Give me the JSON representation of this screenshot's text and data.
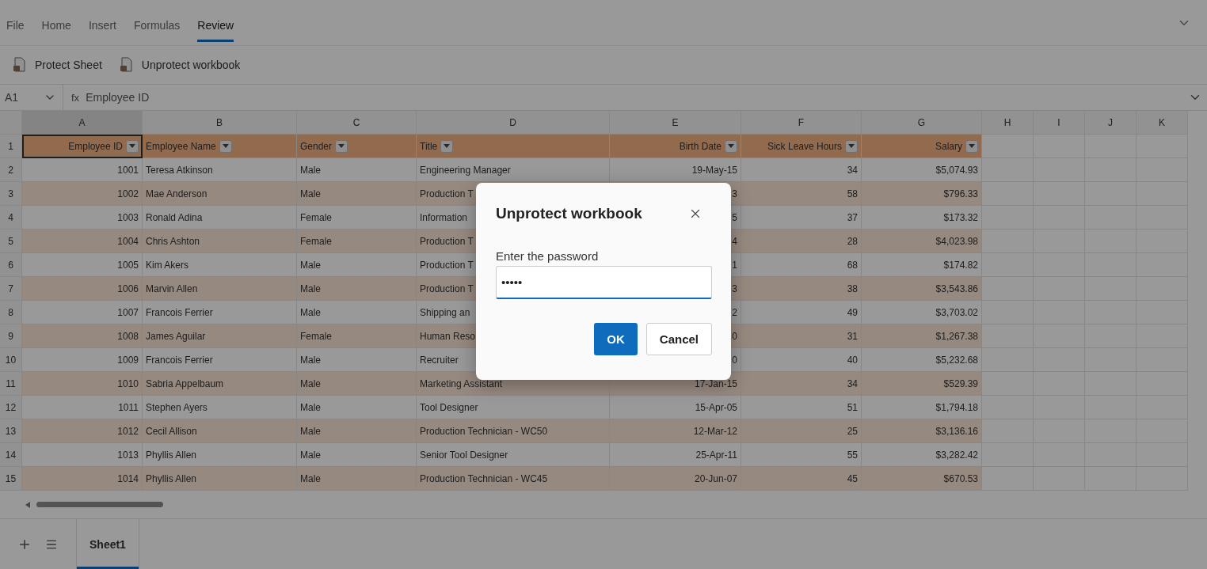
{
  "menu_tabs": [
    {
      "label": "File",
      "selected": false
    },
    {
      "label": "Home",
      "selected": false
    },
    {
      "label": "Insert",
      "selected": false
    },
    {
      "label": "Formulas",
      "selected": false
    },
    {
      "label": "Review",
      "selected": true
    }
  ],
  "toolbar": [
    {
      "label": "Protect Sheet"
    },
    {
      "label": "Unprotect workbook"
    }
  ],
  "formula_bar": {
    "name_box": "A1",
    "fx": "fx",
    "formula": "Employee ID"
  },
  "column_headers": [
    {
      "label": "A",
      "selected": true
    },
    {
      "label": "B",
      "selected": false
    },
    {
      "label": "C",
      "selected": false
    },
    {
      "label": "D",
      "selected": false
    },
    {
      "label": "E",
      "selected": false
    },
    {
      "label": "F",
      "selected": false
    },
    {
      "label": "G",
      "selected": false
    },
    {
      "label": "H",
      "selected": false
    },
    {
      "label": "I",
      "selected": false
    },
    {
      "label": "J",
      "selected": false
    },
    {
      "label": "K",
      "selected": false
    }
  ],
  "header_row": {
    "number": "1",
    "cells": [
      "Employee ID",
      "Employee Name",
      "Gender",
      "Title",
      "Birth Date",
      "Sick Leave Hours",
      "Salary"
    ]
  },
  "rows": [
    {
      "number": "2",
      "cells": [
        "1001",
        "Teresa Atkinson",
        "Male",
        "Engineering Manager",
        "19-May-15",
        "34",
        "$5,074.93"
      ]
    },
    {
      "number": "3",
      "cells": [
        "1002",
        "Mae Anderson",
        "Male",
        "Production T",
        "3",
        "58",
        "$796.33"
      ]
    },
    {
      "number": "4",
      "cells": [
        "1003",
        "Ronald Adina",
        "Female",
        "Information",
        "5",
        "37",
        "$173.32"
      ]
    },
    {
      "number": "5",
      "cells": [
        "1004",
        "Chris Ashton",
        "Female",
        "Production T",
        "4",
        "28",
        "$4,023.98"
      ]
    },
    {
      "number": "6",
      "cells": [
        "1005",
        "Kim Akers",
        "Male",
        "Production T",
        "1",
        "68",
        "$174.82"
      ]
    },
    {
      "number": "7",
      "cells": [
        "1006",
        "Marvin Allen",
        "Male",
        "Production T",
        "3",
        "38",
        "$3,543.86"
      ]
    },
    {
      "number": "8",
      "cells": [
        "1007",
        "Francois Ferrier",
        "Male",
        "Shipping an",
        "2",
        "49",
        "$3,703.02"
      ]
    },
    {
      "number": "9",
      "cells": [
        "1008",
        "James Aguilar",
        "Female",
        "Human Reso",
        "0",
        "31",
        "$1,267.38"
      ]
    },
    {
      "number": "10",
      "cells": [
        "1009",
        "Francois Ferrier",
        "Male",
        "Recruiter",
        "0",
        "40",
        "$5,232.68"
      ]
    },
    {
      "number": "11",
      "cells": [
        "1010",
        "Sabria Appelbaum",
        "Male",
        "Marketing Assistant",
        "17-Jan-15",
        "34",
        "$529.39"
      ]
    },
    {
      "number": "12",
      "cells": [
        "1011",
        "Stephen Ayers",
        "Male",
        "Tool Designer",
        "15-Apr-05",
        "51",
        "$1,794.18"
      ]
    },
    {
      "number": "13",
      "cells": [
        "1012",
        "Cecil Allison",
        "Male",
        "Production Technician - WC50",
        "12-Mar-12",
        "25",
        "$3,136.16"
      ]
    },
    {
      "number": "14",
      "cells": [
        "1013",
        "Phyllis Allen",
        "Male",
        "Senior Tool Designer",
        "25-Apr-11",
        "55",
        "$3,282.42"
      ]
    },
    {
      "number": "15",
      "cells": [
        "1014",
        "Phyllis Allen",
        "Male",
        "Production Technician - WC45",
        "20-Jun-07",
        "45",
        "$670.53"
      ]
    }
  ],
  "sheet_tabs": [
    {
      "label": "Sheet1",
      "selected": true
    }
  ],
  "dialog": {
    "title": "Unprotect workbook",
    "field_label": "Enter the password",
    "value": "•••••",
    "buttons": [
      {
        "label": "OK",
        "kind": "primary"
      },
      {
        "label": "Cancel",
        "kind": "secondary"
      }
    ]
  }
}
